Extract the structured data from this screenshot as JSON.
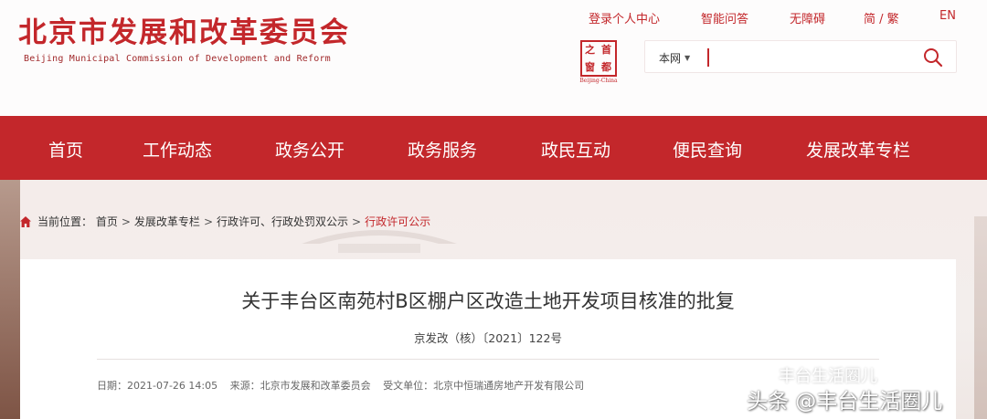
{
  "header": {
    "logo_cn": "北京市发展和改革委员会",
    "logo_en": "Beijing Municipal Commission of Development and Reform",
    "top_links": {
      "login": "登录个人中心",
      "qa": "智能问答",
      "accessibility": "无障碍",
      "lang_switch": "简 / 繁",
      "english": "EN"
    },
    "seal": {
      "chars": [
        "之",
        "首",
        "窗",
        "都"
      ],
      "caption": "Beijing-China"
    },
    "search": {
      "scope": "本网",
      "value": "",
      "placeholder": ""
    }
  },
  "nav": {
    "items": [
      "首页",
      "工作动态",
      "政务公开",
      "政务服务",
      "政民互动",
      "便民查询",
      "发展改革专栏"
    ]
  },
  "breadcrumb": {
    "prefix": "当前位置：",
    "items": [
      "首页",
      "发展改革专栏",
      "行政许可、行政处罚双公示"
    ],
    "current": "行政许可公示",
    "separator": ">"
  },
  "article": {
    "title": "关于丰台区南苑村B区棚户区改造土地开发项目核准的批复",
    "doc_number": "京发改（核）〔2021〕122号",
    "meta": {
      "date": "日期：2021-07-26 14:05",
      "source": "来源：北京市发展和改革委员会",
      "recipient": "受文单位：北京中恒瑞通房地产开发有限公司"
    }
  },
  "watermark": {
    "upper": "丰台生活圈儿",
    "lower": "头条 @丰台生活圈儿"
  },
  "colors": {
    "brand_red": "#c3272b",
    "text": "#333333",
    "band": "#f3eeec"
  }
}
